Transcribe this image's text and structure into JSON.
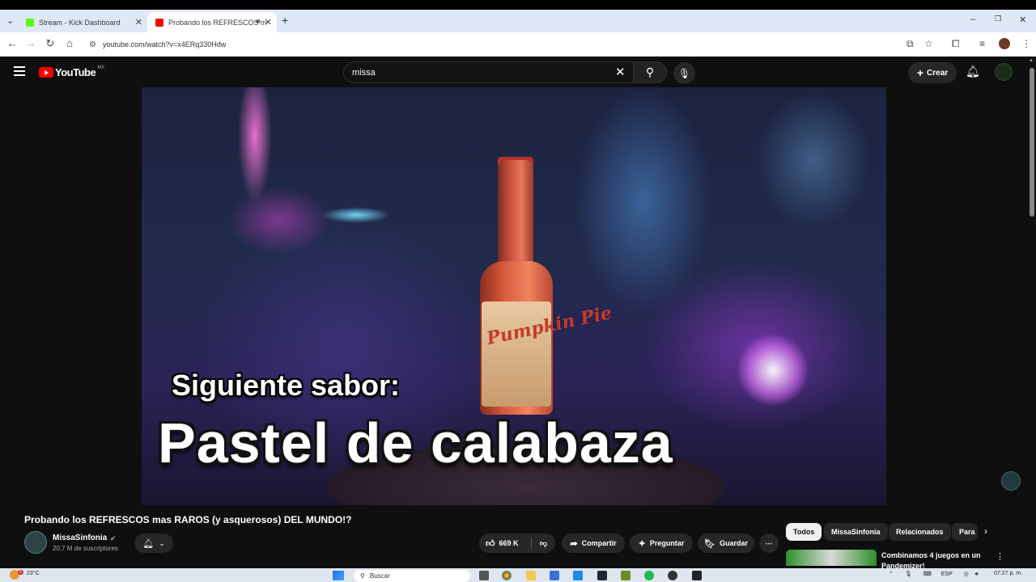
{
  "browser": {
    "tabs": [
      {
        "title": "Stream - Kick Dashboard",
        "icon": "kick-icon",
        "color": "#53fc18"
      },
      {
        "title": "Probando los REFRESCOS m",
        "icon": "youtube-icon",
        "color": "#ff0000"
      }
    ],
    "new_tab": "+",
    "url": "youtube.com/watch?v=x4ERq330Hdw",
    "window_controls": {
      "minimize": "–",
      "maximize": "❐",
      "close": "✕"
    }
  },
  "youtube": {
    "logo_text": "YouTube",
    "country": "MX",
    "search_value": "missa",
    "create_label": "Crear"
  },
  "video": {
    "caption_line1": "Siguiente sabor:",
    "caption_line2": "Pastel de calabaza",
    "bottle_label": "Pumpkin Pie",
    "title": "Probando los REFRESCOS mas RAROS (y asquerosos) DEL MUNDO!?",
    "channel": "MissaSinfonia",
    "subscribers": "20,7 M de suscriptores",
    "likes": "669 K",
    "share_label": "Compartir",
    "ask_label": "Preguntar",
    "save_label": "Guardar"
  },
  "chips": [
    "Todos",
    "MissaSinfonia",
    "Relacionados",
    "Para"
  ],
  "recommendation": {
    "title": "Combinamos 4 juegos en un Pandemizer!"
  },
  "taskbar": {
    "temperature": "23°C",
    "weather_badge": "5",
    "search_placeholder": "Buscar",
    "language": "ESP",
    "time": "07:27 p. m."
  }
}
